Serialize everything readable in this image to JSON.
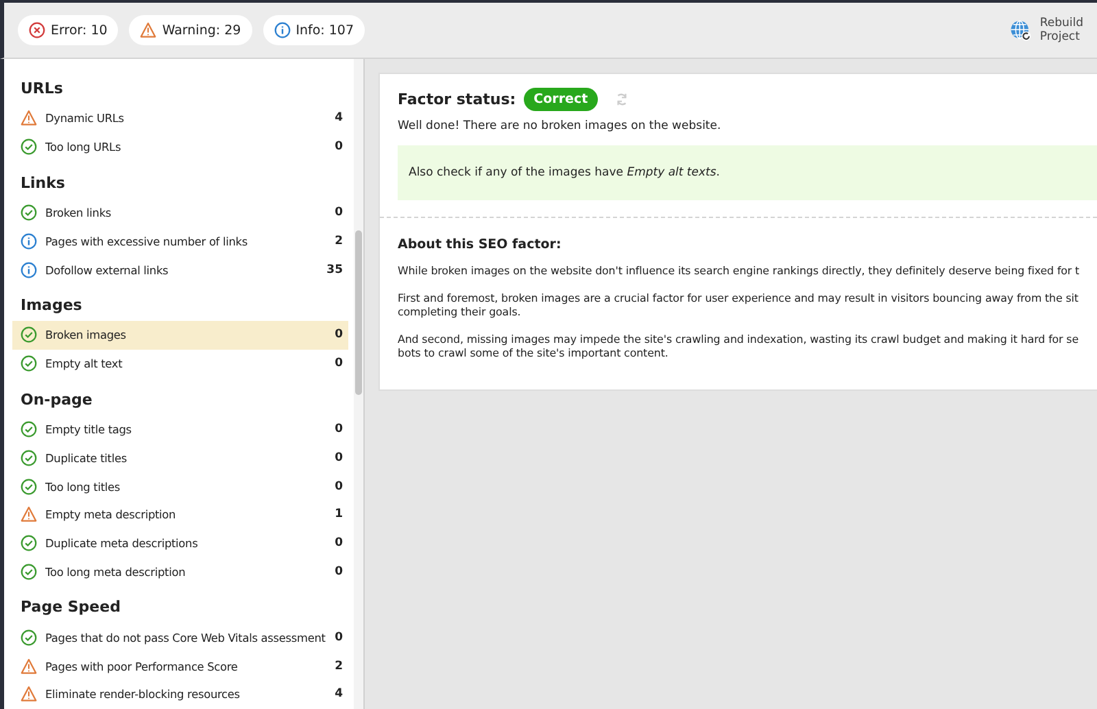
{
  "toolbar": {
    "counters": [
      {
        "kind": "error",
        "label": "Error: 10"
      },
      {
        "kind": "warning",
        "label": "Warning: 29"
      },
      {
        "kind": "info",
        "label": "Info: 107"
      }
    ],
    "rebuild_button": {
      "label_lines": [
        "Rebuild",
        "Project"
      ]
    }
  },
  "sidebar": {
    "groups": [
      {
        "title": "URLs",
        "items": [
          {
            "kind": "warning",
            "label": "Dynamic URLs",
            "count": "4",
            "selected": false
          },
          {
            "kind": "ok",
            "label": "Too long URLs",
            "count": "0",
            "selected": false
          }
        ]
      },
      {
        "title": "Links",
        "items": [
          {
            "kind": "ok",
            "label": "Broken links",
            "count": "0",
            "selected": false
          },
          {
            "kind": "info",
            "label": "Pages with excessive number of links",
            "count": "2",
            "selected": false
          },
          {
            "kind": "info",
            "label": "Dofollow external links",
            "count": "35",
            "selected": false
          }
        ]
      },
      {
        "title": "Images",
        "items": [
          {
            "kind": "ok",
            "label": "Broken images",
            "count": "0",
            "selected": true
          },
          {
            "kind": "ok",
            "label": "Empty alt text",
            "count": "0",
            "selected": false
          }
        ]
      },
      {
        "title": "On-page",
        "items": [
          {
            "kind": "ok",
            "label": "Empty title tags",
            "count": "0",
            "selected": false
          },
          {
            "kind": "ok",
            "label": "Duplicate titles",
            "count": "0",
            "selected": false
          },
          {
            "kind": "ok",
            "label": "Too long titles",
            "count": "0",
            "selected": false
          },
          {
            "kind": "warning",
            "label": "Empty meta description",
            "count": "1",
            "selected": false
          },
          {
            "kind": "ok",
            "label": "Duplicate meta descriptions",
            "count": "0",
            "selected": false
          },
          {
            "kind": "ok",
            "label": "Too long meta description",
            "count": "0",
            "selected": false
          }
        ]
      },
      {
        "title": "Page Speed",
        "items": [
          {
            "kind": "ok",
            "label": "Pages that do not pass Core Web Vitals assessment",
            "count": "0",
            "selected": false
          },
          {
            "kind": "warning",
            "label": "Pages with poor Performance Score",
            "count": "2",
            "selected": false
          },
          {
            "kind": "warning",
            "label": "Eliminate render-blocking resources",
            "count": "4",
            "selected": false
          }
        ]
      }
    ]
  },
  "detail": {
    "status_label": "Factor status:",
    "status_badge": "Correct",
    "message": "Well done! There are no broken images on the website.",
    "hint": "Also check if any of the images have *Empty alt texts*.",
    "about_title": "About this SEO factor:",
    "paragraphs": [
      [
        "While broken images on the website don't influence its search engine rankings directly, they definitely deserve being fixed for t"
      ],
      [
        "First and foremost, broken images are a crucial factor for user experience and may result in visitors bouncing away from the sit",
        "completing their goals."
      ],
      [
        "And second, missing images may impede the site's crawling and indexation, wasting its crawl budget and making it hard for se",
        "bots to crawl some of the site's important content."
      ]
    ]
  }
}
